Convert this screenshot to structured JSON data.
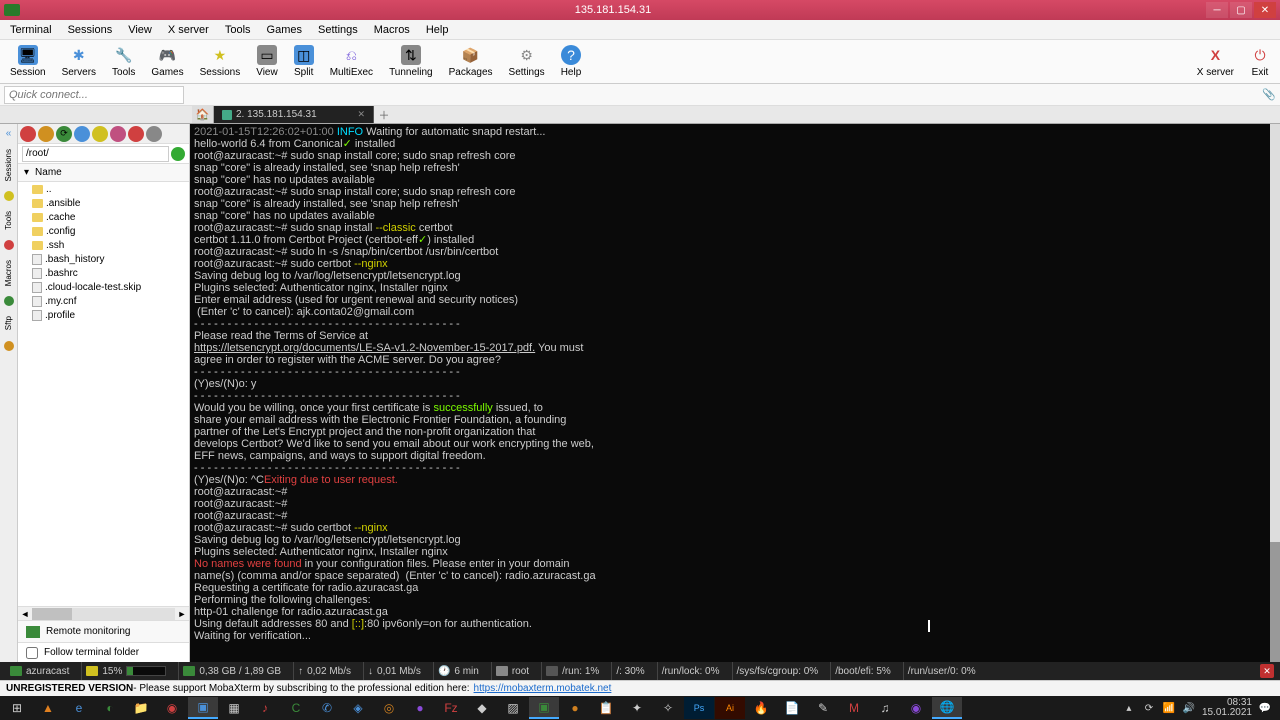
{
  "window": {
    "title": "135.181.154.31"
  },
  "menu": [
    "Terminal",
    "Sessions",
    "View",
    "X server",
    "Tools",
    "Games",
    "Settings",
    "Macros",
    "Help"
  ],
  "toolbar": {
    "session": "Session",
    "servers": "Servers",
    "tools": "Tools",
    "games": "Games",
    "sessions": "Sessions",
    "view": "View",
    "split": "Split",
    "multiexec": "MultiExec",
    "tunneling": "Tunneling",
    "packages": "Packages",
    "settings": "Settings",
    "help": "Help",
    "xserver": "X server",
    "exit": "Exit"
  },
  "quick_connect_placeholder": "Quick connect...",
  "tab": {
    "label": "2. 135.181.154.31"
  },
  "sidebar": {
    "rails": [
      "Sessions",
      "Tools",
      "Macros",
      "Sftp"
    ],
    "path": "/root/",
    "header": "Name",
    "tree": [
      {
        "type": "up",
        "label": ".."
      },
      {
        "type": "folder",
        "label": ".ansible"
      },
      {
        "type": "folder",
        "label": ".cache"
      },
      {
        "type": "folder",
        "label": ".config"
      },
      {
        "type": "folder",
        "label": ".ssh"
      },
      {
        "type": "file",
        "label": ".bash_history"
      },
      {
        "type": "file",
        "label": ".bashrc"
      },
      {
        "type": "file",
        "label": ".cloud-locale-test.skip"
      },
      {
        "type": "file",
        "label": ".my.cnf"
      },
      {
        "type": "file",
        "label": ".profile"
      }
    ],
    "remote_monitoring": "Remote monitoring",
    "follow_terminal": "Follow terminal folder"
  },
  "terminal_lines": [
    [
      {
        "c": "t-gray",
        "t": "2021-01-15T12:26:02+01:00 "
      },
      {
        "c": "t-cyan",
        "t": "INFO"
      },
      {
        "c": "",
        "t": " Waiting for automatic snapd restart..."
      }
    ],
    [
      {
        "c": "",
        "t": "hello-world 6.4 from Canonical"
      },
      {
        "c": "t-green",
        "t": "✓"
      },
      {
        "c": "",
        "t": " installed"
      }
    ],
    [
      {
        "c": "",
        "t": "root@azuracast:~# sudo snap install core; sudo snap refresh core"
      }
    ],
    [
      {
        "c": "",
        "t": "snap \"core\" is already installed, see 'snap help refresh'"
      }
    ],
    [
      {
        "c": "",
        "t": "snap \"core\" has no updates available"
      }
    ],
    [
      {
        "c": "",
        "t": "root@azuracast:~# sudo snap install core; sudo snap refresh core"
      }
    ],
    [
      {
        "c": "",
        "t": "snap \"core\" is already installed, see 'snap help refresh'"
      }
    ],
    [
      {
        "c": "",
        "t": "snap \"core\" has no updates available"
      }
    ],
    [
      {
        "c": "",
        "t": "root@azuracast:~# sudo snap install "
      },
      {
        "c": "t-yellow",
        "t": "--classic"
      },
      {
        "c": "",
        "t": " certbot"
      }
    ],
    [
      {
        "c": "",
        "t": "certbot 1.11.0 from Certbot Project (certbot-eff"
      },
      {
        "c": "t-green",
        "t": "✓"
      },
      {
        "c": "",
        "t": ") installed"
      }
    ],
    [
      {
        "c": "",
        "t": "root@azuracast:~# sudo ln -s /snap/bin/certbot /usr/bin/certbot"
      }
    ],
    [
      {
        "c": "",
        "t": "root@azuracast:~# sudo certbot "
      },
      {
        "c": "t-yellow",
        "t": "--nginx"
      }
    ],
    [
      {
        "c": "",
        "t": "Saving debug log to /var/log/letsencrypt/letsencrypt.log"
      }
    ],
    [
      {
        "c": "",
        "t": "Plugins selected: Authenticator nginx, Installer nginx"
      }
    ],
    [
      {
        "c": "",
        "t": "Enter email address (used for urgent renewal and security notices)"
      }
    ],
    [
      {
        "c": "",
        "t": " (Enter 'c' to cancel): ajk.conta02@gmail.com"
      }
    ],
    [
      {
        "c": "",
        "t": ""
      }
    ],
    [
      {
        "c": "",
        "t": "- - - - - - - - - - - - - - - - - - - - - - - - - - - - - - - - - - - - - - - -"
      }
    ],
    [
      {
        "c": "",
        "t": "Please read the Terms of Service at"
      }
    ],
    [
      {
        "c": "t-underline",
        "t": "https://letsencrypt.org/documents/LE-SA-v1.2-November-15-2017.pdf."
      },
      {
        "c": "",
        "t": " You must"
      }
    ],
    [
      {
        "c": "",
        "t": "agree in order to register with the ACME server. Do you agree?"
      }
    ],
    [
      {
        "c": "",
        "t": "- - - - - - - - - - - - - - - - - - - - - - - - - - - - - - - - - - - - - - - -"
      }
    ],
    [
      {
        "c": "",
        "t": "(Y)es/(N)o: y"
      }
    ],
    [
      {
        "c": "",
        "t": ""
      }
    ],
    [
      {
        "c": "",
        "t": "- - - - - - - - - - - - - - - - - - - - - - - - - - - - - - - - - - - - - - - -"
      }
    ],
    [
      {
        "c": "",
        "t": "Would you be willing, once your first certificate is "
      },
      {
        "c": "t-green",
        "t": "successfully"
      },
      {
        "c": "",
        "t": " issued, to"
      }
    ],
    [
      {
        "c": "",
        "t": "share your email address with the Electronic Frontier Foundation, a founding"
      }
    ],
    [
      {
        "c": "",
        "t": "partner of the Let's Encrypt project and the non-profit organization that"
      }
    ],
    [
      {
        "c": "",
        "t": "develops Certbot? We'd like to send you email about our work encrypting the web,"
      }
    ],
    [
      {
        "c": "",
        "t": "EFF news, campaigns, and ways to support digital freedom."
      }
    ],
    [
      {
        "c": "",
        "t": "- - - - - - - - - - - - - - - - - - - - - - - - - - - - - - - - - - - - - - - -"
      }
    ],
    [
      {
        "c": "",
        "t": "(Y)es/(N)o: ^C"
      },
      {
        "c": "t-red",
        "t": "Exiting due to user request."
      }
    ],
    [
      {
        "c": "",
        "t": "root@azuracast:~#"
      }
    ],
    [
      {
        "c": "",
        "t": "root@azuracast:~#"
      }
    ],
    [
      {
        "c": "",
        "t": "root@azuracast:~#"
      }
    ],
    [
      {
        "c": "",
        "t": "root@azuracast:~# sudo certbot "
      },
      {
        "c": "t-yellow",
        "t": "--nginx"
      }
    ],
    [
      {
        "c": "",
        "t": "Saving debug log to /var/log/letsencrypt/letsencrypt.log"
      }
    ],
    [
      {
        "c": "",
        "t": "Plugins selected: Authenticator nginx, Installer nginx"
      }
    ],
    [
      {
        "c": "t-red",
        "t": "No names were found"
      },
      {
        "c": "",
        "t": " in your configuration files. Please enter in your domain"
      }
    ],
    [
      {
        "c": "",
        "t": "name(s) (comma and/or space separated)  (Enter 'c' to cancel): radio.azuracast.ga"
      }
    ],
    [
      {
        "c": "",
        "t": "Requesting a certificate for radio.azuracast.ga"
      }
    ],
    [
      {
        "c": "",
        "t": "Performing the following challenges:"
      }
    ],
    [
      {
        "c": "",
        "t": "http-01 challenge for radio.azuracast.ga"
      }
    ],
    [
      {
        "c": "",
        "t": "Using default addresses 80 and "
      },
      {
        "c": "t-yellow",
        "t": "[::]"
      },
      {
        "c": "",
        "t": ":80 ipv6only=on for authentication."
      }
    ],
    [
      {
        "c": "",
        "t": "Waiting for verification..."
      }
    ]
  ],
  "status": {
    "host": "azuracast",
    "cpu_pct": "15%",
    "mem": "0,38 GB / 1,89 GB",
    "up": "0,02 Mb/s",
    "down": "0,01 Mb/s",
    "uptime": "6 min",
    "user": "root",
    "run": "/run: 1%",
    "root": "/: 30%",
    "runlock": "/run/lock: 0%",
    "cgroup": "/sys/fs/cgroup: 0%",
    "bootefi": "/boot/efi: 5%",
    "runuser": "/run/user/0: 0%"
  },
  "footer": {
    "unreg": "UNREGISTERED VERSION",
    "msg": " - Please support MobaXterm by subscribing to the professional edition here: ",
    "link": "https://mobaxterm.mobatek.net"
  },
  "tray": {
    "time": "08:31",
    "date": "15.01.2021"
  }
}
